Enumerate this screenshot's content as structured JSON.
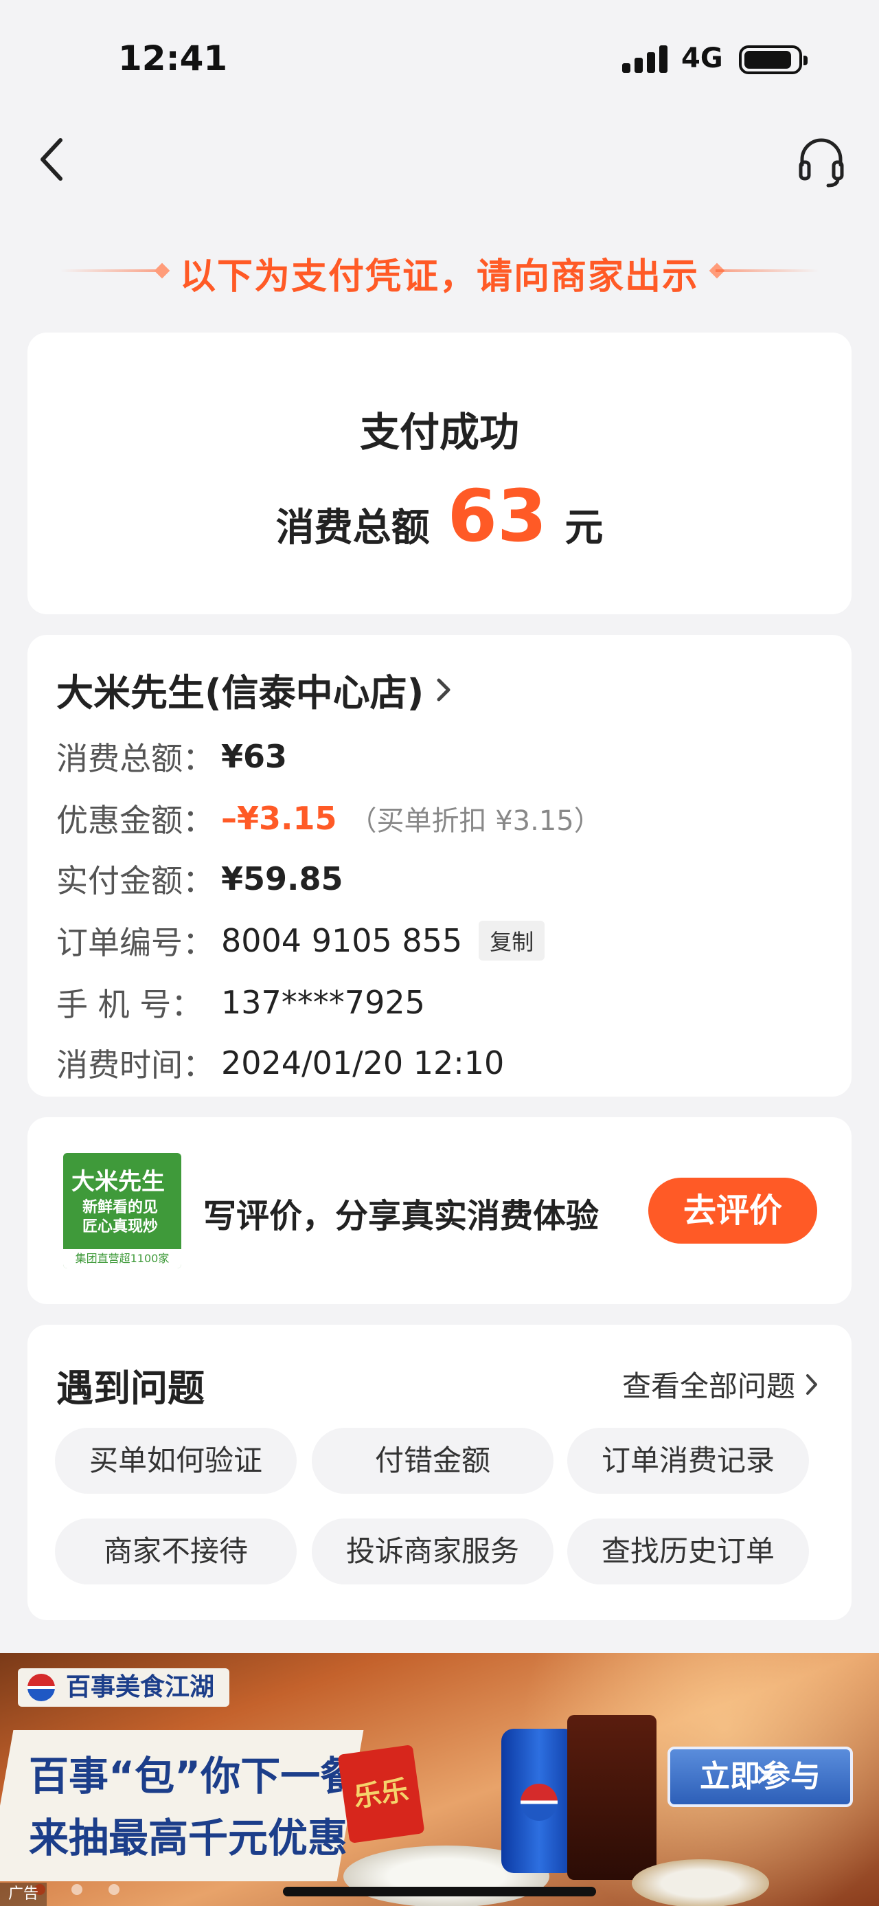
{
  "status_bar": {
    "time": "12:41",
    "network": "4G"
  },
  "header": {
    "voucher_note": "以下为支付凭证，请向商家出示"
  },
  "payment": {
    "status": "支付成功",
    "total_label": "消费总额",
    "total_amount": "63",
    "total_unit": "元"
  },
  "order": {
    "store_name": "大米先生(信泰中心店)",
    "rows": [
      {
        "key": "消费总额：",
        "value": "¥63"
      },
      {
        "key": "优惠金额：",
        "value": "–¥3.15",
        "note": "（买单折扣 ¥3.15）"
      },
      {
        "key": "实付金额：",
        "value": "¥59.85"
      },
      {
        "key": "订单编号：",
        "value": "8004 9105 855",
        "action": "复制"
      },
      {
        "key": "手  机  号：",
        "value": "137****7925"
      },
      {
        "key": "消费时间：",
        "value": "2024/01/20 12:10"
      }
    ]
  },
  "review": {
    "logo_title": "大米先生",
    "logo_slogan_1": "新鲜看的见",
    "logo_slogan_2": "匠心真现炒",
    "logo_footer": "集团直营超1100家",
    "prompt": "写评价，分享真实消费体验",
    "button": "去评价"
  },
  "faq": {
    "title": "遇到问题",
    "view_all": "查看全部问题",
    "chips": [
      "买单如何验证",
      "付错金额",
      "订单消费记录",
      "商家不接待",
      "投诉商家服务",
      "查找历史订单"
    ]
  },
  "ad": {
    "brand": "百事美食江湖",
    "line1": "百事“包”你下一餐!",
    "line2": "来抽最高千元优惠",
    "red_packet": "乐乐",
    "cta": "立即参与",
    "tag": "广告",
    "slides_total": 3,
    "active_slide": 1
  },
  "colors": {
    "accent": "#ff5a26",
    "background": "#f3f3f5",
    "card": "#ffffff"
  }
}
